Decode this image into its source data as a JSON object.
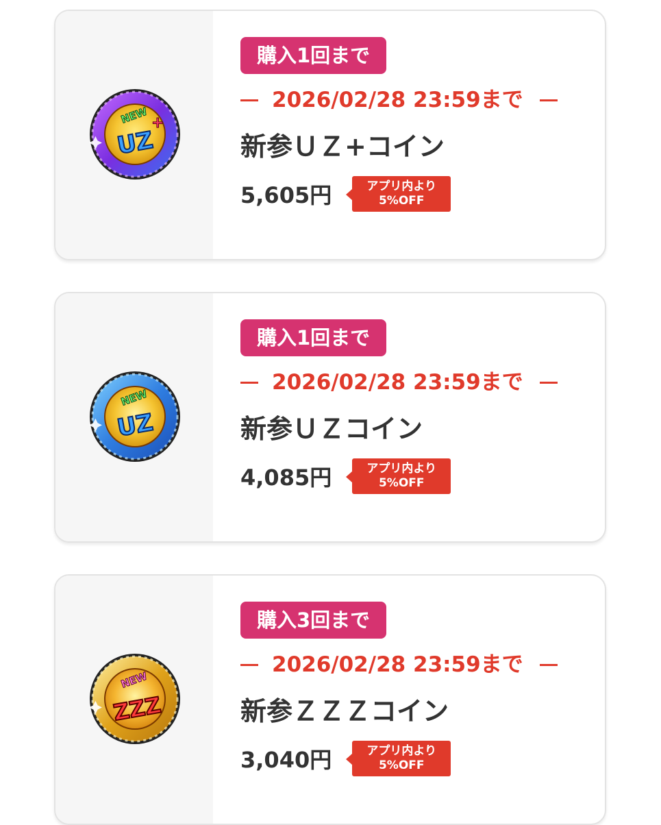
{
  "products": [
    {
      "limit": "購入1回まで",
      "deadline": "2026/02/28 23:59まで",
      "name": "新参ＵＺ+コイン",
      "price": "5,605円",
      "discount_line1": "アプリ内より",
      "discount_line2": "5%OFF",
      "coin_icon": "new-uz-plus-coin-icon",
      "coin_text": "NEW UZ+",
      "coin_color": "#8a3fd8"
    },
    {
      "limit": "購入1回まで",
      "deadline": "2026/02/28 23:59まで",
      "name": "新参ＵＺコイン",
      "price": "4,085円",
      "discount_line1": "アプリ内より",
      "discount_line2": "5%OFF",
      "coin_icon": "new-uz-coin-icon",
      "coin_text": "NEW UZ",
      "coin_color": "#2f7de0"
    },
    {
      "limit": "購入3回まで",
      "deadline": "2026/02/28 23:59まで",
      "name": "新参ＺＺＺコイン",
      "price": "3,040円",
      "discount_line1": "アプリ内より",
      "discount_line2": "5%OFF",
      "coin_icon": "new-zzz-coin-icon",
      "coin_text": "NEW ZZZ",
      "coin_color": "#e0a21a"
    }
  ],
  "colors": {
    "limit_badge": "#d63370",
    "deadline": "#e03a2b",
    "discount": "#e03a2b",
    "text": "#333333"
  }
}
